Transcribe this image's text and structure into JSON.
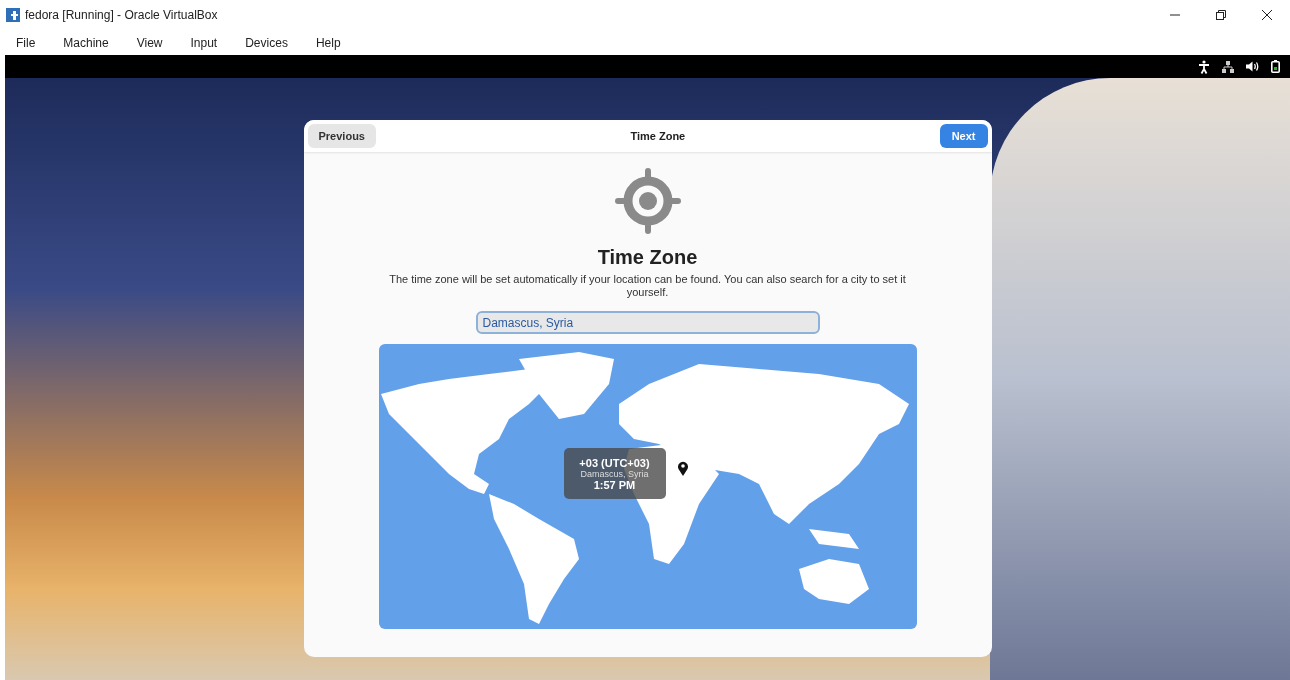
{
  "window": {
    "title": "fedora [Running] - Oracle VirtualBox"
  },
  "menu": [
    "File",
    "Machine",
    "View",
    "Input",
    "Devices",
    "Help"
  ],
  "dialog": {
    "header_title": "Time Zone",
    "previous_button": "Previous",
    "next_button": "Next",
    "heading": "Time Zone",
    "description": "The time zone will be set automatically if your location can be found. You can also search for a city to set it yourself.",
    "search": {
      "value": "Damascus, Syria"
    },
    "tooltip": {
      "offset": "+03 (UTC+03)",
      "city": "Damascus, Syria",
      "time": "1:57 PM"
    }
  }
}
